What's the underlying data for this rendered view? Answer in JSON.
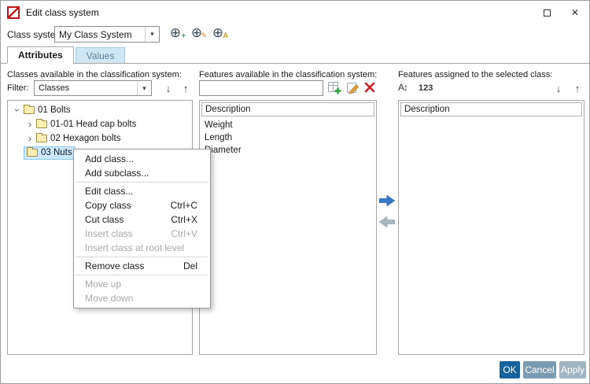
{
  "window": {
    "title": "Edit class system"
  },
  "toolbar": {
    "class_system_label": "Class system:",
    "class_system_value": "My Class System"
  },
  "tabs": {
    "attributes": "Attributes",
    "values": "Values"
  },
  "classes_panel": {
    "header": "Classes available in the classification system:",
    "filter_label": "Filter:",
    "filter_value": "Classes",
    "tree": [
      {
        "label": "01 Bolts"
      },
      {
        "label": "01-01 Head cap bolts"
      },
      {
        "label": "02 Hexagon bolts"
      },
      {
        "label": "03 Nuts"
      }
    ]
  },
  "features_panel": {
    "header": "Features available in the classification system:",
    "search_value": "",
    "column_header": "Description",
    "items": [
      {
        "label": "Weight"
      },
      {
        "label": "Length"
      },
      {
        "label": "Diameter"
      }
    ]
  },
  "assigned_panel": {
    "header": "Features assigned to the selected class:",
    "sort_numeric_label": "123",
    "column_header": "Description",
    "items": []
  },
  "context_menu": {
    "items": [
      {
        "label": "Add class..."
      },
      {
        "label": "Add subclass..."
      },
      {
        "label": "Edit class..."
      },
      {
        "label": "Copy class",
        "shortcut": "Ctrl+C"
      },
      {
        "label": "Cut class",
        "shortcut": "Ctrl+X"
      },
      {
        "label": "Insert class",
        "shortcut": "Ctrl+V"
      },
      {
        "label": "Insert class at root level"
      },
      {
        "label": "Remove class",
        "shortcut": "Del"
      },
      {
        "label": "Move up"
      },
      {
        "label": "Move down"
      }
    ]
  },
  "footer": {
    "ok_label": "OK",
    "cancel_label": "Cancel",
    "apply_label": "Apply"
  },
  "icons": {
    "close": "✕",
    "dropdown": "▾",
    "chevron": "›",
    "down_arrow": "↓",
    "up_arrow": "↑",
    "sort_alpha": "A↕",
    "circle_plus": "⊕",
    "badge_plus": "+",
    "badge_pencil": "✎",
    "badge_letter": "A"
  },
  "colors": {
    "selection_bg": "#cce8ff",
    "selection_border": "#90c8f0",
    "ok_button": "#15629c",
    "arrow_enabled": "#3a78c9",
    "arrow_disabled": "#aab6be"
  }
}
